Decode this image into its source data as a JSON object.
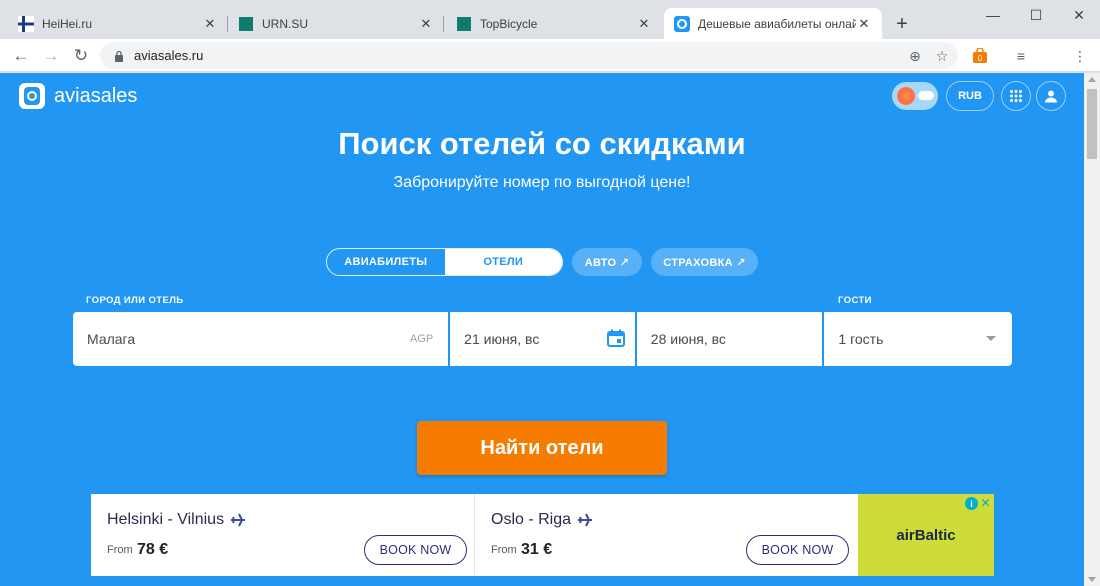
{
  "browser": {
    "tabs": [
      {
        "title": "HeiHei.ru",
        "icon": "finland-flag-icon"
      },
      {
        "title": "URN.SU",
        "icon": "teal-square-icon"
      },
      {
        "title": "TopBicycle",
        "icon": "teal-square-icon"
      },
      {
        "title": "Дешевые авиабилеты онлайн, це",
        "icon": "aviasales-icon"
      }
    ],
    "url": "aviasales.ru",
    "extension_badge": "0"
  },
  "header": {
    "logo_text": "aviasales",
    "currency": "RUB"
  },
  "hero": {
    "title": "Поиск отелей со скидками",
    "subtitle": "Забронируйте номер по выгодной цене!"
  },
  "mode_tabs": {
    "flights": "АВИАБИЛЕТЫ",
    "hotels": "ОТЕЛИ",
    "cars": "АВТО ↗",
    "insurance": "СТРАХОВКА ↗",
    "selected": "hotels"
  },
  "form": {
    "city_label": "ГОРОД ИЛИ ОТЕЛЬ",
    "guests_label": "ГОСТИ",
    "city_value": "Малага",
    "city_code": "AGP",
    "checkin": "21 июня, вс",
    "checkout": "28 июня, вс",
    "guests": "1 гость",
    "submit": "Найти отели"
  },
  "ad": {
    "offers": [
      {
        "route": "Helsinki - Vilnius",
        "from_label": "From",
        "price": "78 €",
        "cta": "BOOK NOW"
      },
      {
        "route": "Oslo - Riga",
        "from_label": "From",
        "price": "31 €",
        "cta": "BOOK NOW"
      }
    ],
    "brand": "airBaltic",
    "brand_color": "#cddc39"
  },
  "colors": {
    "page_bg": "#2196f3",
    "search_button": "#f57c00"
  }
}
